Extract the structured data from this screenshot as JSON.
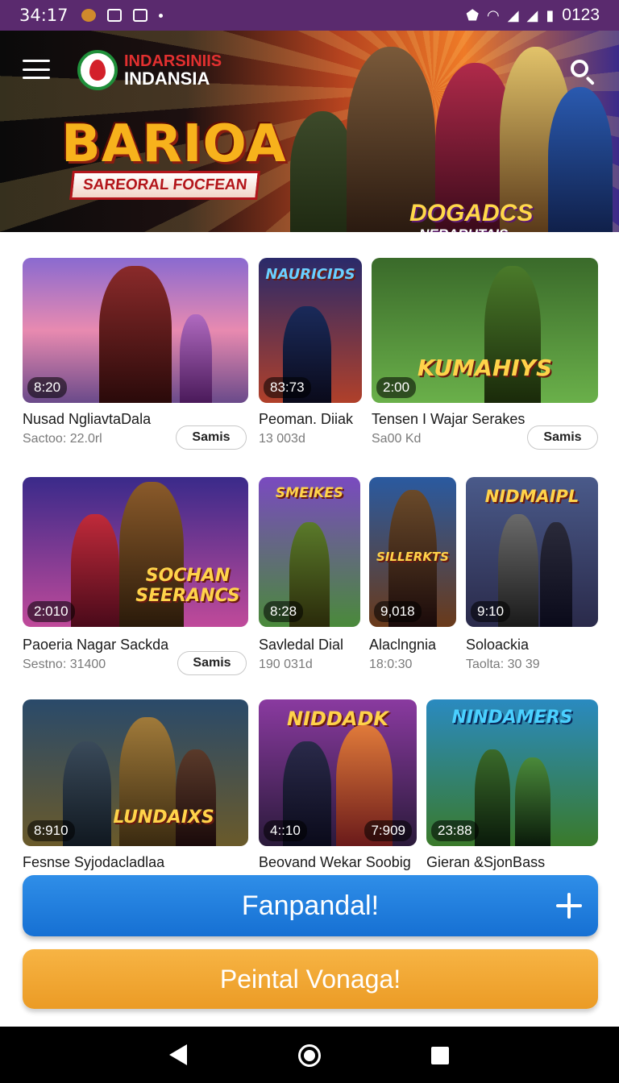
{
  "status_bar": {
    "time": "34:17",
    "right_text": "0123",
    "icons": [
      "notification-app-icon",
      "gallery-icon",
      "image-icon",
      "dot-icon",
      "shield-icon",
      "wifi-icon",
      "signal-icon",
      "signal-icon",
      "battery-icon"
    ]
  },
  "header": {
    "logo_line1": "INDARSINIIS",
    "logo_line2": "INDANSIA",
    "game_title": "BARIOA",
    "game_subtitle": "SAREORAL FOCFEAN",
    "badge_title": "DOGADCS",
    "badge_sub": "NERARUTAIS",
    "colors": {
      "accent": "#f7b21c",
      "dark": "#0a0a0a"
    }
  },
  "videos": [
    {
      "thumb_text": "",
      "duration": "8:20",
      "title": "Nusad NgliavtaDala",
      "meta": "Sactoo: 22.0rl",
      "button": "Samis"
    },
    {
      "thumb_text": "NAURICIDS",
      "duration": "83:73",
      "title": "Peoman. Diiak",
      "meta": "13 003d"
    },
    {
      "thumb_text": "KUMAHIYS",
      "duration": "2:00",
      "title": "Tensen I Wajar Serakes",
      "meta": "Sa00 Kd",
      "button": "Samis"
    },
    {
      "thumb_text": "SOCHAN SEERANCS",
      "duration": "2:010",
      "title": "Paoeria Nagar Sackda",
      "meta": "Sestno: 31400",
      "button": "Samis"
    },
    {
      "thumb_text": "SMEIKES",
      "duration": "8:28",
      "title": "Savledal Dial",
      "meta": "190 031d"
    },
    {
      "thumb_text": "SILLERKTS",
      "duration": "9,018",
      "title": "Alaclngnia",
      "meta": "18:0:30"
    },
    {
      "thumb_text": "NIDMAIPL",
      "duration": "9:10",
      "title": "Soloackia",
      "meta": "Taolta: 30 39"
    },
    {
      "thumb_text": "LUNDAIXS",
      "duration": "8:910",
      "title": "Fesnse Syjodacladlaa",
      "meta": ""
    },
    {
      "thumb_text": "NIDDADK",
      "duration": "4::10",
      "duration2": "7:909",
      "title": "Beovand Wekar Soobig",
      "meta": ""
    },
    {
      "thumb_text": "NINDAMERS",
      "duration": "23:88",
      "title": "Gieran &SjonBass",
      "meta": ""
    }
  ],
  "actions": {
    "primary": "Fanpandal!",
    "secondary": "Peintal Vonaga!",
    "colors": {
      "primary": "#1f7fde",
      "secondary": "#f0a733"
    }
  },
  "nav": {
    "icons": [
      "back-icon",
      "home-icon",
      "recents-icon"
    ]
  }
}
